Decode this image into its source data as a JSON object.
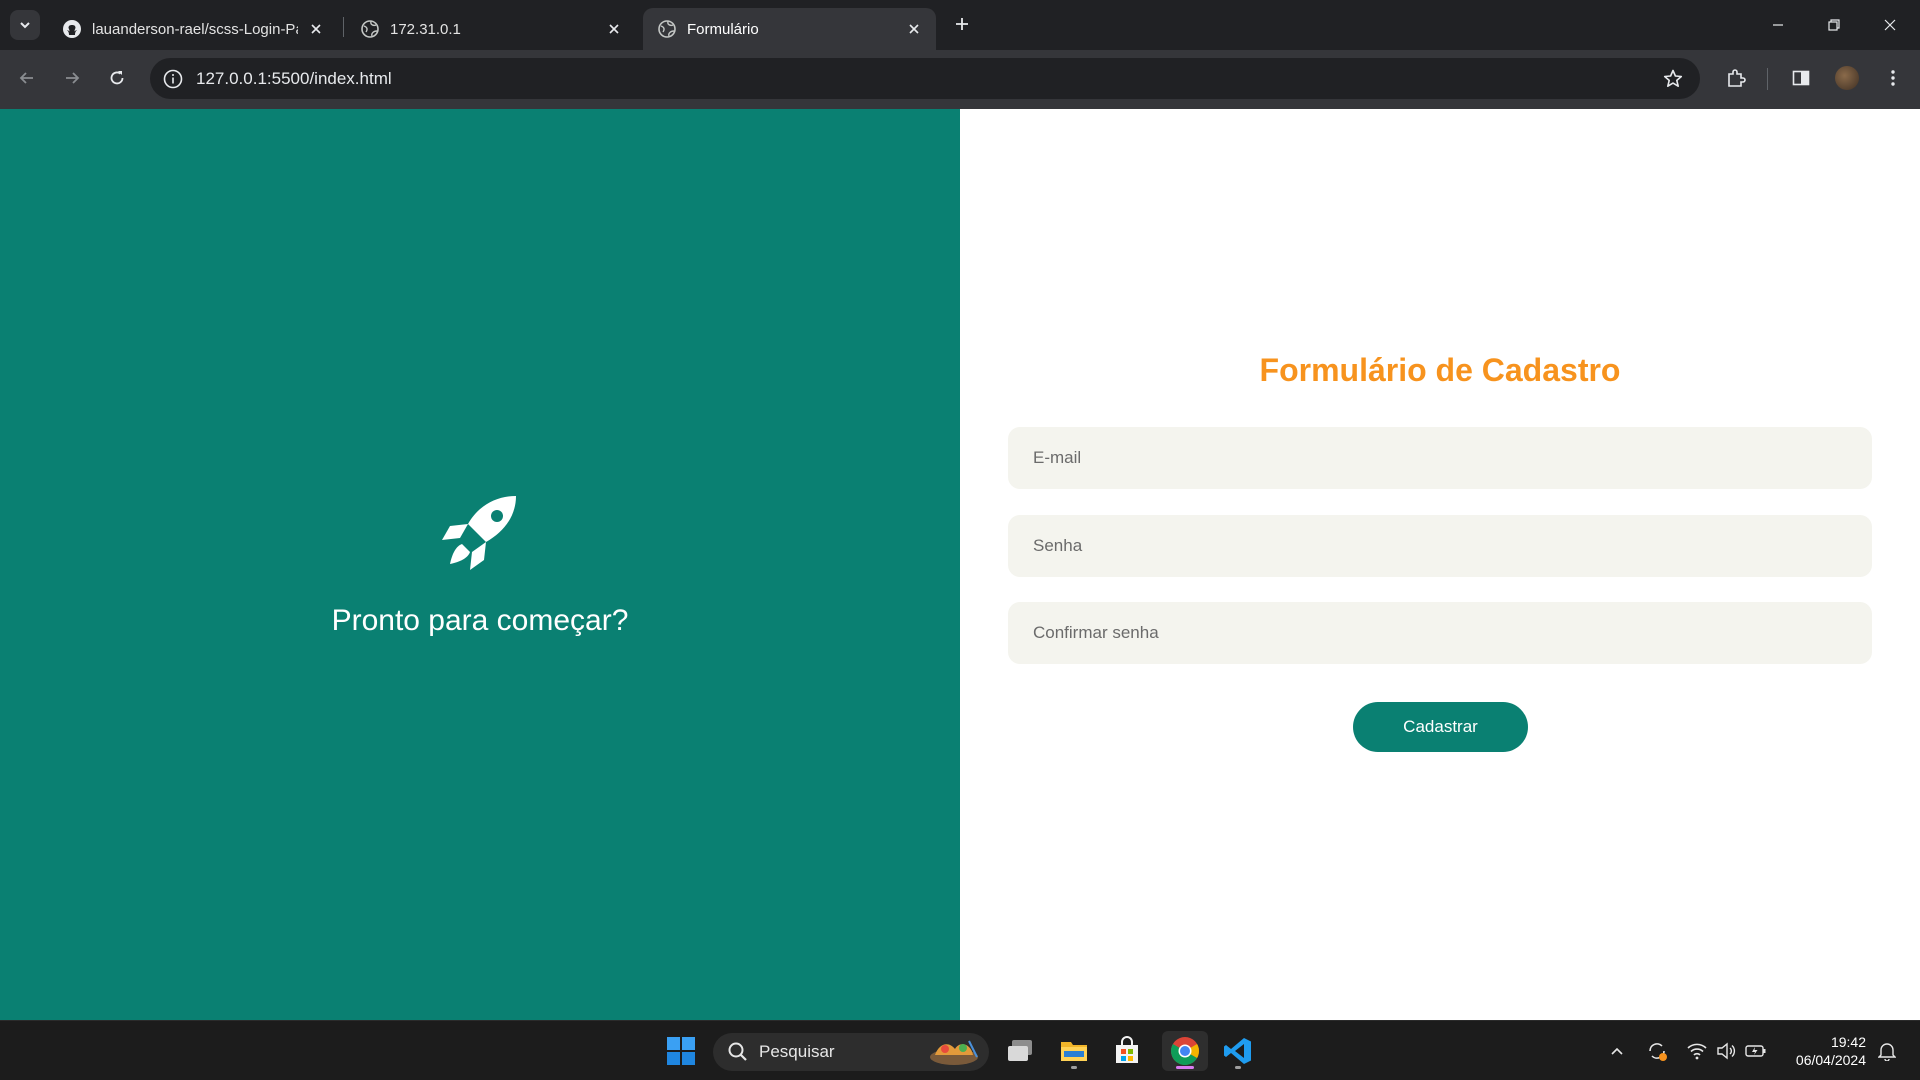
{
  "browser": {
    "tabs": [
      {
        "title": "lauanderson-rael/scss-Login-Pa",
        "icon": "github-icon"
      },
      {
        "title": "172.31.0.1",
        "icon": "globe-icon"
      },
      {
        "title": "Formulário",
        "icon": "globe-icon",
        "active": true
      }
    ],
    "url": "127.0.0.1:5500/index.html"
  },
  "page": {
    "left": {
      "icon": "rocket-icon",
      "heading": "Pronto para começar?",
      "background": "#0a8072"
    },
    "form": {
      "title": "Formulário de Cadastro",
      "title_color": "#f7931e",
      "email_placeholder": "E-mail",
      "password_placeholder": "Senha",
      "confirm_placeholder": "Confirmar senha",
      "submit_label": "Cadastrar"
    }
  },
  "taskbar": {
    "search_label": "Pesquisar",
    "time": "19:42",
    "date": "06/04/2024",
    "apps": [
      "windows-start-icon",
      "task-view-icon",
      "file-explorer-icon",
      "microsoft-store-icon",
      "chrome-icon",
      "vscode-icon"
    ]
  }
}
